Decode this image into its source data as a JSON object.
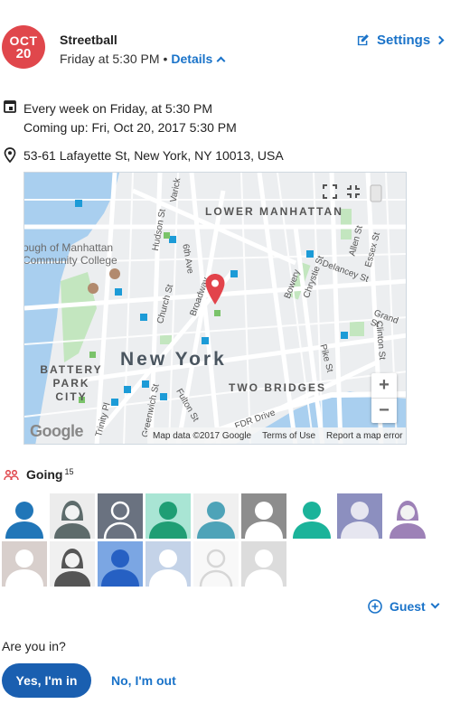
{
  "event": {
    "month": "OCT",
    "day": "20",
    "title": "Streetball",
    "when": "Friday at 5:30 PM",
    "dot": "•",
    "details_label": "Details",
    "settings_label": "Settings"
  },
  "schedule": {
    "line1": "Every week on Friday, at 5:30 PM",
    "line2": "Coming up: Fri, Oct 20, 2017 5:30 PM"
  },
  "location": {
    "address": "53-61 Lafayette St, New York, NY 10013, USA"
  },
  "map": {
    "neighborhood_labels": [
      "LOWER MANHATTAN",
      "BATTERY PARK CITY",
      "TWO BRIDGES"
    ],
    "city_label": "New York",
    "college_label": "ough of Manhattan Community College",
    "street_labels": [
      "Hudson St",
      "6th Ave",
      "Church St",
      "Broadway",
      "Bowery",
      "Chrystie St",
      "Allen St",
      "Essex St",
      "Delancey St",
      "Grand St",
      "Clinton St",
      "Pike St",
      "FDR Drive",
      "Fulton St",
      "Trinity Pl",
      "Varick",
      "Greenwich St"
    ],
    "zoom_in": "+",
    "zoom_out": "−",
    "google_logo": "Google",
    "attribution": "Map data ©2017 Google",
    "terms": "Terms of Use",
    "report": "Report a map error"
  },
  "attendees": {
    "label": "Going",
    "count": "15",
    "avatars": [
      {
        "bg": "#ffffff",
        "fg": "#2176b8",
        "kind": "person"
      },
      {
        "bg": "#ececec",
        "fg": "#5d6b6b",
        "kind": "woman"
      },
      {
        "bg": "#6a7280",
        "fg": "#ffffff",
        "kind": "outline"
      },
      {
        "bg": "#a9e5d4",
        "fg": "#1f9e74",
        "kind": "person"
      },
      {
        "bg": "#f0f0f0",
        "fg": "#4ea3b8",
        "kind": "person"
      },
      {
        "bg": "#8d8d8d",
        "fg": "#ffffff",
        "kind": "person"
      },
      {
        "bg": "#ffffff",
        "fg": "#1bb39a",
        "kind": "person"
      },
      {
        "bg": "#8c8fbf",
        "fg": "#e6e6f0",
        "kind": "person"
      },
      {
        "bg": "#ffffff",
        "fg": "#9d81b7",
        "kind": "woman"
      },
      {
        "bg": "#d8cfcc",
        "fg": "#ffffff",
        "kind": "person"
      },
      {
        "bg": "#f0f0f0",
        "fg": "#555555",
        "kind": "woman"
      },
      {
        "bg": "#7ba6e3",
        "fg": "#2660c3",
        "kind": "person"
      },
      {
        "bg": "#c4d3e8",
        "fg": "#ffffff",
        "kind": "person"
      },
      {
        "bg": "#f8f8f8",
        "fg": "#d6d6d6",
        "kind": "outline"
      },
      {
        "bg": "#dcdcdc",
        "fg": "#ffffff",
        "kind": "person"
      }
    ]
  },
  "guest_label": "Guest",
  "rsvp": {
    "question": "Are you in?",
    "yes_label": "Yes, I'm in",
    "no_label": "No, I'm out"
  },
  "colors": {
    "accent": "#1a73c9",
    "badge": "#e0474c",
    "yes_button": "#1a5fb0"
  }
}
